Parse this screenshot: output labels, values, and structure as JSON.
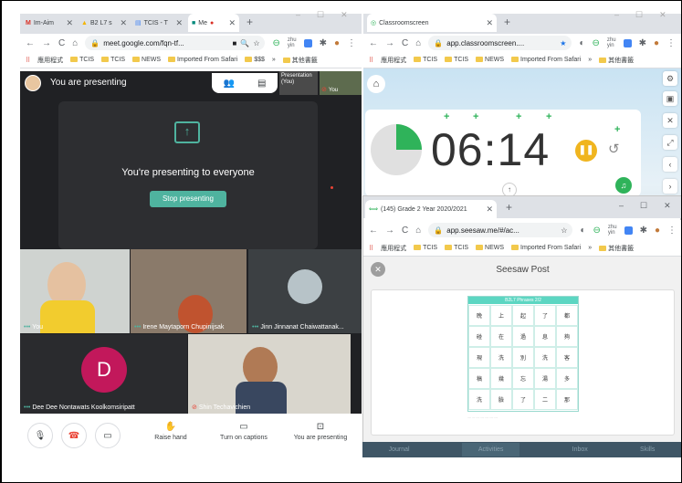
{
  "left_browser": {
    "tabs": [
      {
        "label": "Im-Aim",
        "icon": "gmail-icon"
      },
      {
        "label": "B2 L7 s",
        "icon": "drive-icon"
      },
      {
        "label": "TCIS - T",
        "icon": "doc-icon"
      },
      {
        "label": "Me",
        "icon": "meet-icon"
      }
    ],
    "url": "meet.google.com/fqn-tf...",
    "bookmarks": [
      "應用程式",
      "TCIS",
      "TCIS",
      "NEWS",
      "Imported From Safari",
      "$$$",
      "»",
      "其他書籤"
    ]
  },
  "meet": {
    "presenter_banner": "You are presenting",
    "self_preview_label": "Presentation (You)",
    "self_name_short": "You",
    "presenting_message": "You're presenting to everyone",
    "stop_button": "Stop presenting",
    "participants": [
      {
        "name": "You"
      },
      {
        "name": "Irene Maytaporn Chupinijsak"
      },
      {
        "name": "Jinn Jinnanat Chaiwattanak..."
      },
      {
        "name": "Dee Dee Nontawats Koolkomsiripatt",
        "avatar_letter": "D"
      },
      {
        "name": "Shin Techavichien"
      }
    ],
    "controls": {
      "raise_hand": "Raise hand",
      "captions": "Turn on captions",
      "present": "You are presenting"
    }
  },
  "right_browser": {
    "tab": "Classroomscreen",
    "url": "app.classroomscreen....",
    "bookmarks": [
      "應用程式",
      "TCIS",
      "TCIS",
      "NEWS",
      "Imported From Safari",
      "»",
      "其他書籤"
    ]
  },
  "timer": {
    "display": "06:14",
    "progress_fraction": 0.25
  },
  "seesaw_window": {
    "tab": "(145) Grade 2 Year 2020/2021",
    "url": "app.seesaw.me/#/ac...",
    "bookmarks": [
      "應用程式",
      "TCIS",
      "TCIS",
      "NEWS",
      "Imported From Safari",
      "»",
      "其他書籤"
    ],
    "post_title": "Seesaw Post",
    "worksheet_title": "B2L7 Phrases 2/2",
    "grid": [
      [
        "晚",
        "上",
        "起",
        "了",
        "都"
      ],
      [
        "碰",
        "在",
        "過",
        "息",
        "夠"
      ],
      [
        "現",
        "洗",
        "別",
        "洗",
        "客"
      ],
      [
        "稿",
        "幾",
        "忘",
        "湯",
        "多"
      ],
      [
        "洗",
        "臉",
        "了",
        "二",
        "那"
      ]
    ]
  },
  "bottom_nav": [
    "Journal",
    "Activities",
    "Inbox",
    "Skills"
  ],
  "colors": {
    "meet_bg": "#202124",
    "teal": "#4fb39f",
    "timer_green": "#2fb35a",
    "pause_yellow": "#f0b51f",
    "avatar_red": "#c2185b"
  }
}
